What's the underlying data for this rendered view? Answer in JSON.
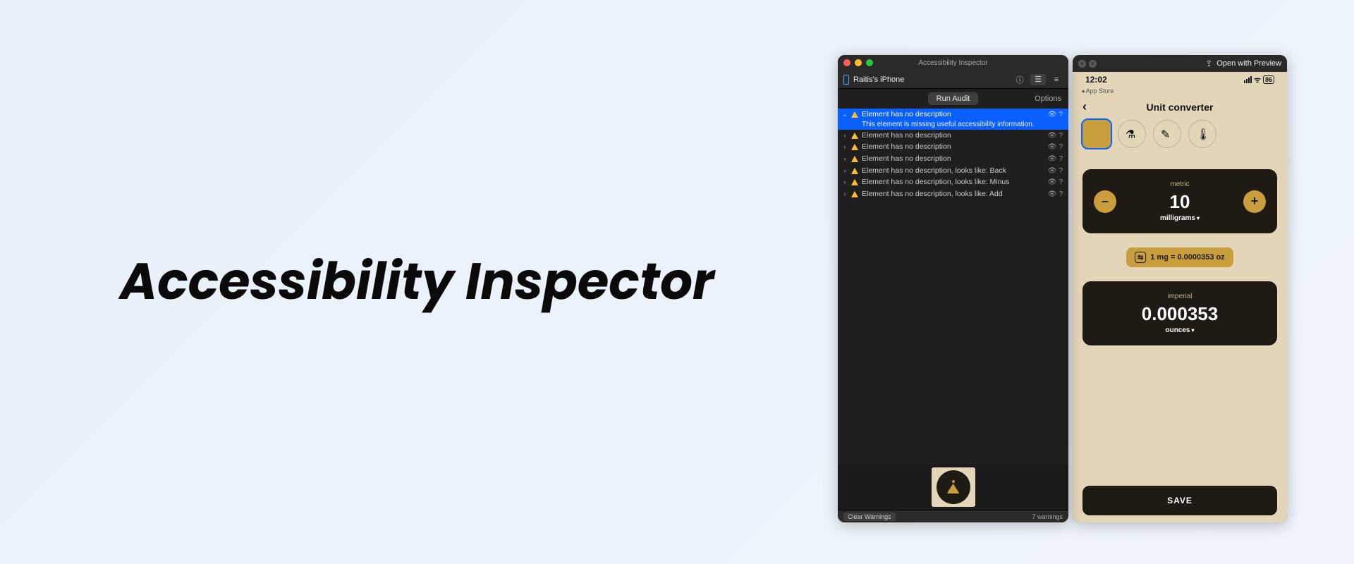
{
  "page": {
    "title": "Accessibility Inspector"
  },
  "inspector": {
    "window_title": "Accessibility Inspector",
    "device": "Raitis's iPhone",
    "run_audit": "Run Audit",
    "options": "Options",
    "selected_issue": {
      "title": "Element has no description",
      "detail": "This element is missing useful accessibility information."
    },
    "issues": [
      "Element has no description",
      "Element has no description",
      "Element has no description",
      "Element has no description, looks like: Back",
      "Element has no description, looks like: Minus",
      "Element has no description, looks like: Add"
    ],
    "clear_warnings": "Clear Warnings",
    "warning_count": "7 warnings"
  },
  "phone": {
    "open_with": "Open with Preview",
    "clock": "12:02",
    "battery": "86",
    "back_app": "◂ App Store",
    "title": "Unit converter",
    "metric": {
      "label": "metric",
      "value": "10",
      "unit": "milligrams"
    },
    "swap": "1 mg = 0.0000353 oz",
    "imperial": {
      "label": "imperial",
      "value": "0.000353",
      "unit": "ounces"
    },
    "save": "SAVE"
  }
}
